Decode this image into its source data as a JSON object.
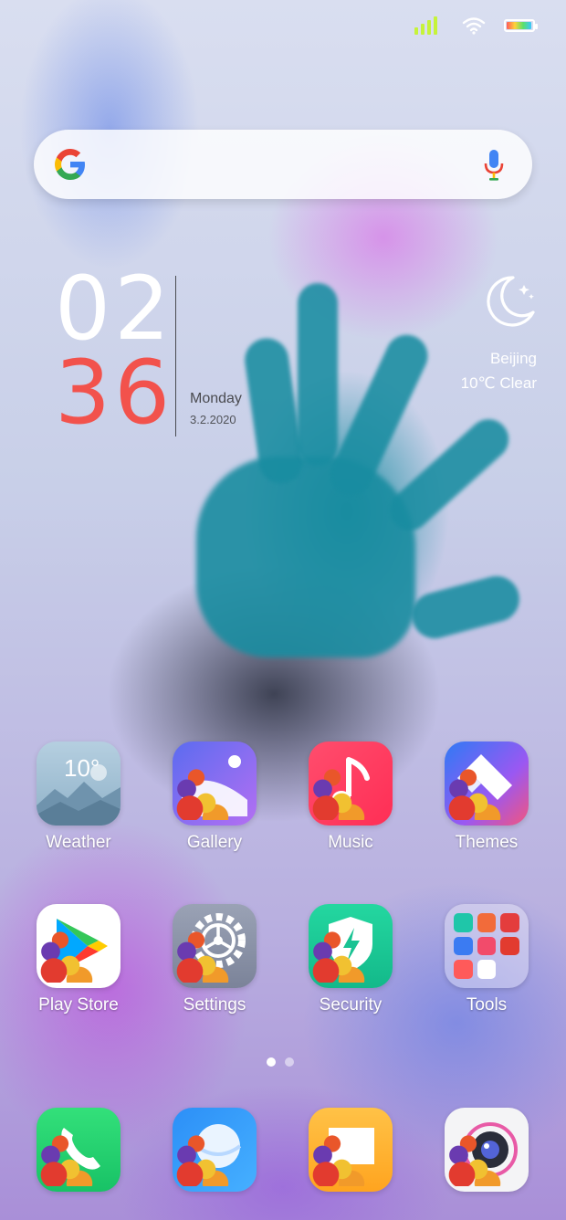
{
  "search": {
    "logo": "google-g-icon",
    "voice": "microphone-icon"
  },
  "clock": {
    "hour": "02",
    "minute": "36",
    "day": "Monday",
    "date": "3.2.2020"
  },
  "weather_widget": {
    "icon": "moon-stars-icon",
    "city": "Beijing",
    "condition": "10℃  Clear"
  },
  "apps": [
    {
      "label": "Weather",
      "icon": "weather-icon",
      "badge": "10°"
    },
    {
      "label": "Gallery",
      "icon": "gallery-icon"
    },
    {
      "label": "Music",
      "icon": "music-note-icon"
    },
    {
      "label": "Themes",
      "icon": "themes-brush-icon"
    },
    {
      "label": "Play Store",
      "icon": "play-store-icon"
    },
    {
      "label": "Settings",
      "icon": "gear-icon"
    },
    {
      "label": "Security",
      "icon": "shield-bolt-icon"
    },
    {
      "label": "Tools",
      "icon": "folder-icon"
    }
  ],
  "pagination": {
    "pages": 2,
    "current": 1
  },
  "dock": [
    {
      "icon": "phone-icon"
    },
    {
      "icon": "browser-icon"
    },
    {
      "icon": "messages-icon"
    },
    {
      "icon": "camera-icon"
    }
  ],
  "status_bar": {
    "battery_level": 0.95
  },
  "colors": {
    "clock_minute": "#f2524c",
    "clock_hour": "#ffffff"
  }
}
